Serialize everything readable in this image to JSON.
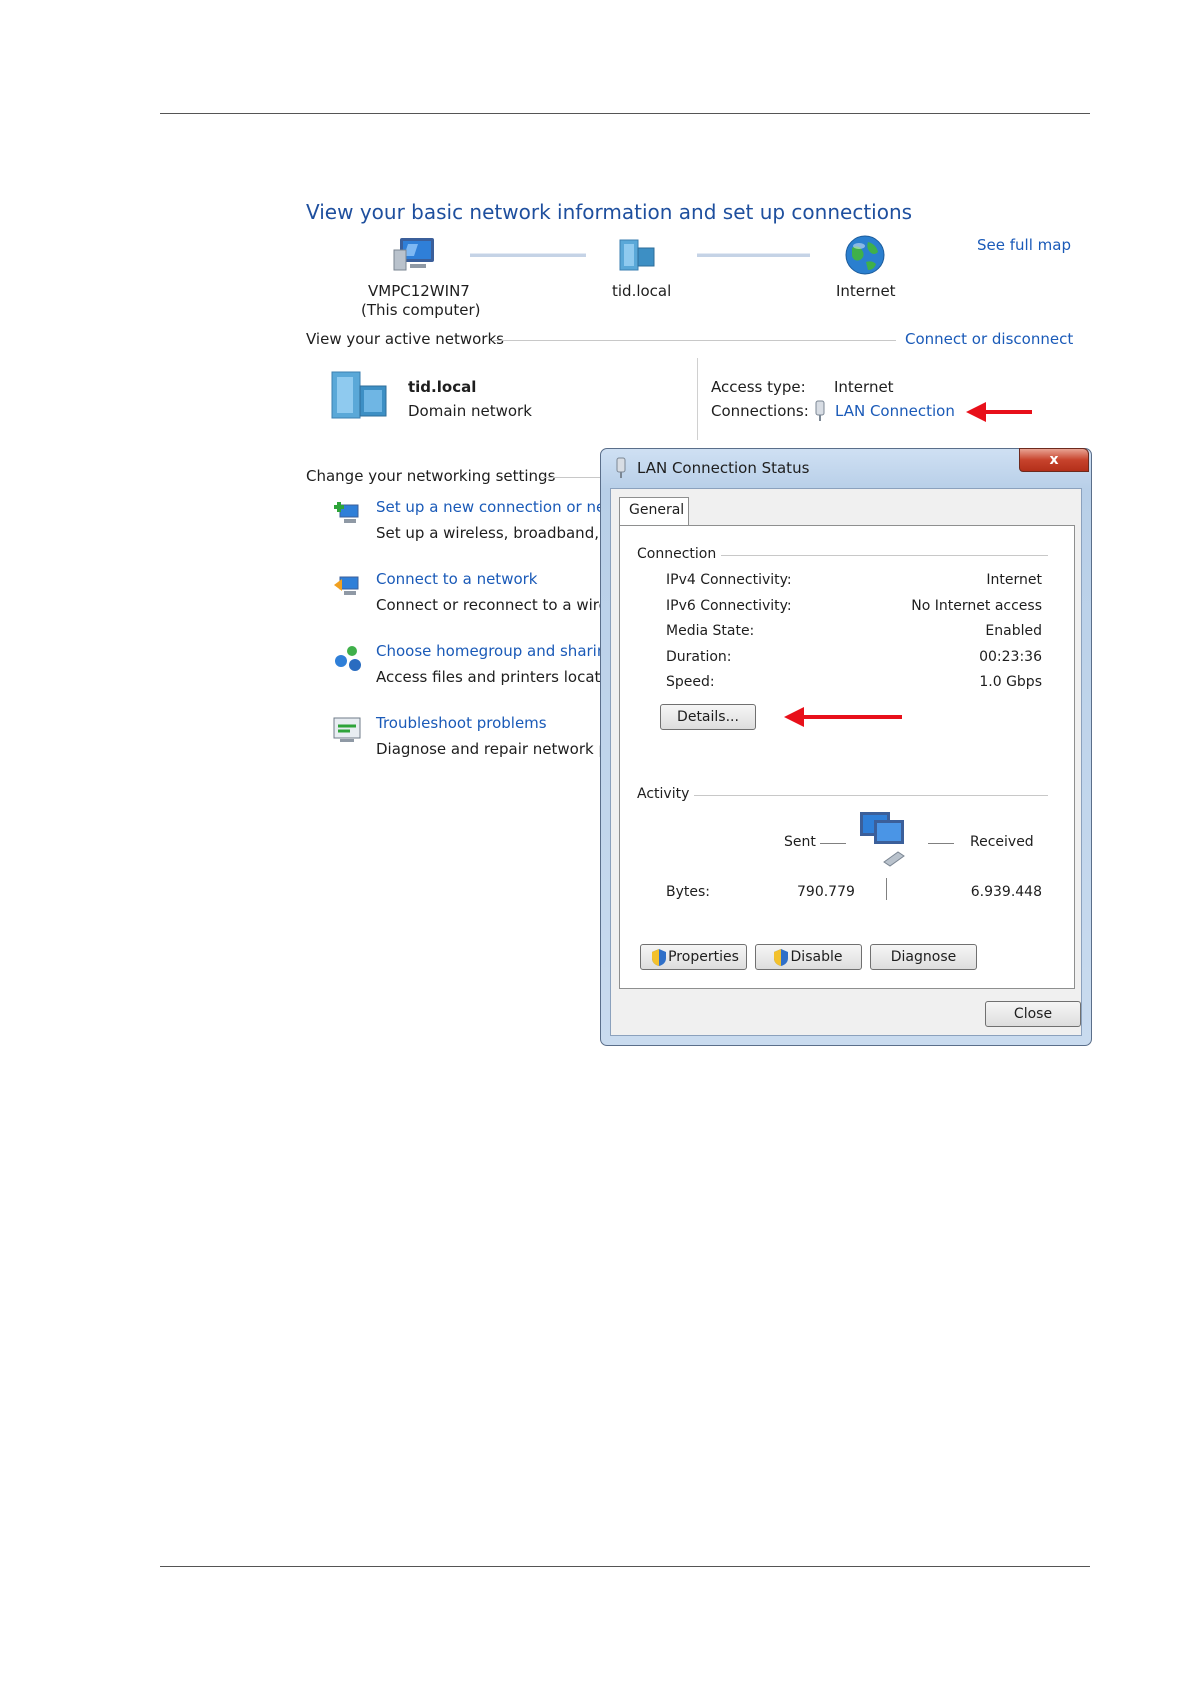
{
  "page": {
    "title": "View your basic network information and set up connections",
    "see_full_map": "See full map"
  },
  "map": {
    "computer_name": "VMPC12WIN7",
    "computer_sub": "(This computer)",
    "domain_name": "tid.local",
    "internet_label": "Internet"
  },
  "active": {
    "heading": "View your active networks",
    "connect_link": "Connect or disconnect",
    "network_name": "tid.local",
    "network_type": "Domain network",
    "access_label": "Access type:",
    "access_value": "Internet",
    "connections_label": "Connections:",
    "connections_value": "LAN Connection"
  },
  "settings": {
    "heading": "Change your networking settings",
    "items": [
      {
        "title": "Set up a new connection or netw",
        "desc": "Set up a wireless, broadband, dia"
      },
      {
        "title": "Connect to a network",
        "desc": "Connect or reconnect to a wirele"
      },
      {
        "title": "Choose homegroup and sharing",
        "desc": "Access files and printers located"
      },
      {
        "title": "Troubleshoot problems",
        "desc": "Diagnose and repair network pro"
      }
    ]
  },
  "dialog": {
    "title": "LAN Connection Status",
    "close_glyph": "x",
    "tab": "General",
    "connection_heading": "Connection",
    "rows": [
      {
        "label": "IPv4 Connectivity:",
        "value": "Internet"
      },
      {
        "label": "IPv6 Connectivity:",
        "value": "No Internet access"
      },
      {
        "label": "Media State:",
        "value": "Enabled"
      },
      {
        "label": "Duration:",
        "value": "00:23:36"
      },
      {
        "label": "Speed:",
        "value": "1.0 Gbps"
      }
    ],
    "details_button": "Details...",
    "activity_heading": "Activity",
    "sent_label": "Sent",
    "received_label": "Received",
    "bytes_label": "Bytes:",
    "bytes_sent": "790.779",
    "bytes_received": "6.939.448",
    "properties_button": "Properties",
    "disable_button": "Disable",
    "diagnose_button": "Diagnose",
    "close_button": "Close"
  },
  "colors": {
    "link": "#1a5ab8",
    "title": "#1e4f9e",
    "arrow": "#e8101a"
  }
}
